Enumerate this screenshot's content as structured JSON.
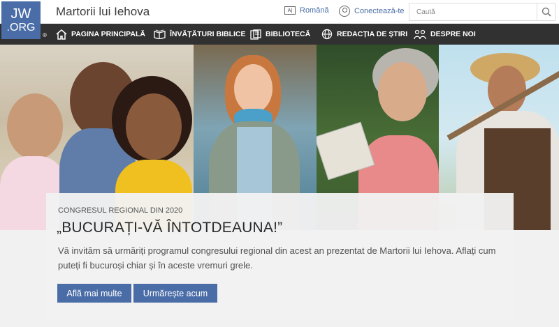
{
  "logo": {
    "line1": "JW",
    "line2": ".ORG",
    "registered": "®"
  },
  "header": {
    "site_title": "Martorii lui Iehova",
    "language_label": "Română",
    "language_icon_text": "A|",
    "login_label": "Conectează-te",
    "search_placeholder": "Caută"
  },
  "nav": {
    "items": [
      {
        "label": "PAGINA PRINCIPALĂ",
        "icon": "home-icon"
      },
      {
        "label": "ÎNVĂȚĂTURI BIBLICE",
        "icon": "open-bible-icon"
      },
      {
        "label": "BIBLIOTECĂ",
        "icon": "library-icon"
      },
      {
        "label": "REDACȚIA DE ȘTIRI",
        "icon": "globe-icon"
      },
      {
        "label": "DESPRE NOI",
        "icon": "people-icon"
      }
    ]
  },
  "hero": {
    "kicker": "CONGRESUL REGIONAL DIN 2020",
    "headline": "„BUCURAȚI-VĂ ÎNTOTDEAUNA!”",
    "body": "Vă invităm să urmăriți programul congresului regional din acest an prezentat de Martorii lui Iehova. Aflați cum puteți fi bucuroși chiar și în aceste vremuri grele.",
    "primary_button": "Află mai multe",
    "secondary_button": "Urmărește acum"
  },
  "colors": {
    "brand": "#4a6da7",
    "nav_bg": "#313131",
    "page_bg": "#f1f1f1"
  }
}
